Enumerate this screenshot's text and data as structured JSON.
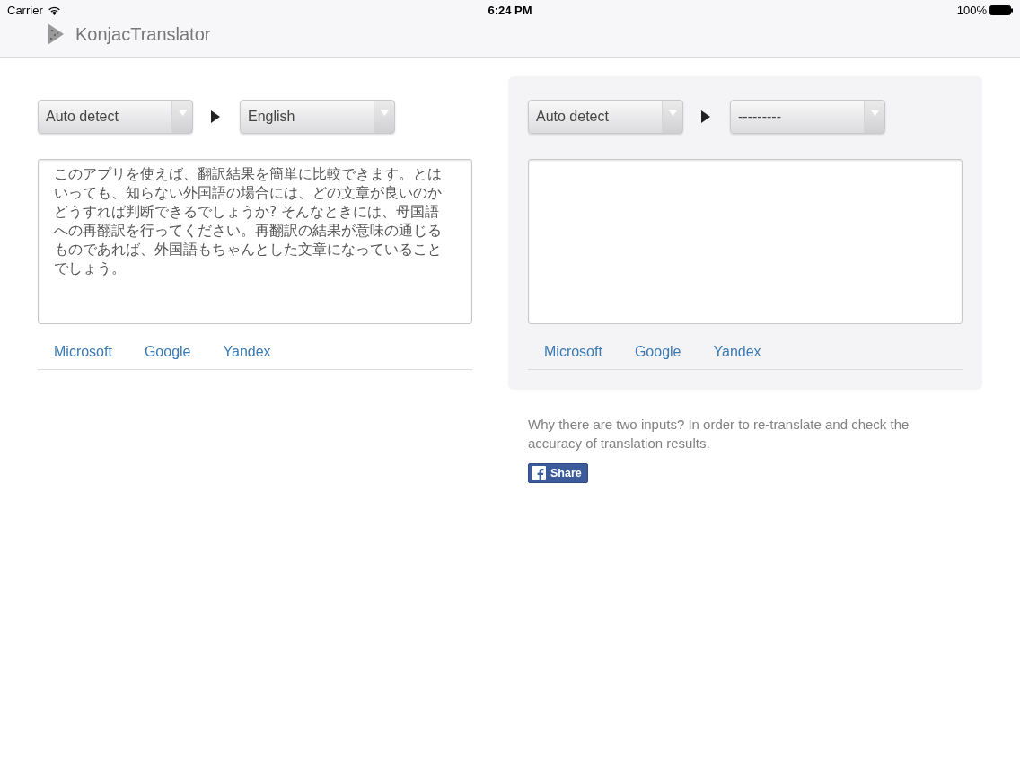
{
  "status_bar": {
    "carrier": "Carrier",
    "time": "6:24 PM",
    "battery": "100%"
  },
  "header": {
    "title": "KonjacTranslator"
  },
  "panes": [
    {
      "highlighted": false,
      "source_language": "Auto detect",
      "target_language": "English",
      "text": "このアプリを使えば、翻訳結果を簡単に比較できます。とはいっても、知らない外国語の場合には、どの文章が良いのかどうすれば判断できるでしょうか? そんなときには、母国語への再翻訳を行ってください。再翻訳の結果が意味の通じるものであれば、外国語もちゃんとした文章になっていることでしょう。",
      "engines": [
        "Microsoft",
        "Google",
        "Yandex"
      ]
    },
    {
      "highlighted": true,
      "source_language": "Auto detect",
      "target_language": "---------",
      "engines": [
        "Microsoft",
        "Google",
        "Yandex"
      ]
    }
  ],
  "note": "Why there are two inputs? In order to re-translate and check the accuracy of translation results.",
  "share_button": "Share"
}
